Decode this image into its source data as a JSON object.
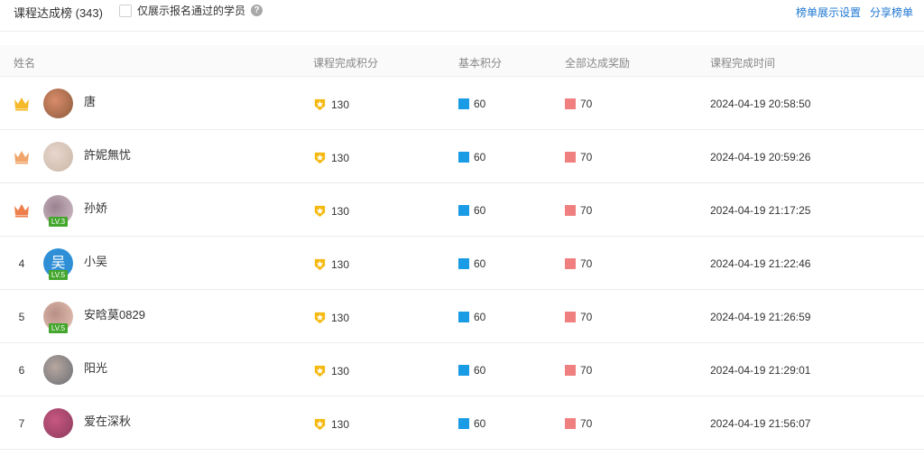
{
  "header": {
    "title": "课程达成榜 (343)",
    "filter_label": "仅展示报名通过的学员",
    "help_icon": "question-icon",
    "actions": [
      "榜单展示设置",
      "分享榜单"
    ]
  },
  "table": {
    "columns": [
      "姓名",
      "课程完成积分",
      "基本积分",
      "全部达成奖励",
      "课程完成时间"
    ],
    "rows": [
      {
        "rank": "",
        "crown": "gold",
        "name": "唐",
        "level": "",
        "score": "130",
        "base": "60",
        "reward": "70",
        "time": "2024-04-19 20:58:50",
        "avatar": "photo"
      },
      {
        "rank": "",
        "crown": "silver",
        "name": "許妮無忧",
        "level": "",
        "score": "130",
        "base": "60",
        "reward": "70",
        "time": "2024-04-19 20:59:26",
        "avatar": "photo"
      },
      {
        "rank": "",
        "crown": "bronze",
        "name": "孙娇",
        "level": "LV.3",
        "score": "130",
        "base": "60",
        "reward": "70",
        "time": "2024-04-19 21:17:25",
        "avatar": "photo"
      },
      {
        "rank": "4",
        "crown": "",
        "name": "小吴",
        "level": "LV.5",
        "score": "130",
        "base": "60",
        "reward": "70",
        "time": "2024-04-19 21:22:46",
        "avatar": "letter",
        "avatar_text": "吴"
      },
      {
        "rank": "5",
        "crown": "",
        "name": "安晗莫0829",
        "level": "LV.5",
        "score": "130",
        "base": "60",
        "reward": "70",
        "time": "2024-04-19 21:26:59",
        "avatar": "photo"
      },
      {
        "rank": "6",
        "crown": "",
        "name": "阳光",
        "level": "",
        "score": "130",
        "base": "60",
        "reward": "70",
        "time": "2024-04-19 21:29:01",
        "avatar": "photo"
      },
      {
        "rank": "7",
        "crown": "",
        "name": "爱在深秋",
        "level": "",
        "score": "130",
        "base": "60",
        "reward": "70",
        "time": "2024-04-19 21:56:07",
        "avatar": "photo"
      }
    ]
  },
  "colors": {
    "link": "#1e78d2",
    "base_square": "#1a9be6",
    "reward_square": "#f08080",
    "score_badge": "#f5b90f",
    "level_badge": "#44a62d",
    "crown_gold": "#f6b92b",
    "crown_silver": "#f2a56a",
    "crown_bronze": "#ee7f4c"
  }
}
